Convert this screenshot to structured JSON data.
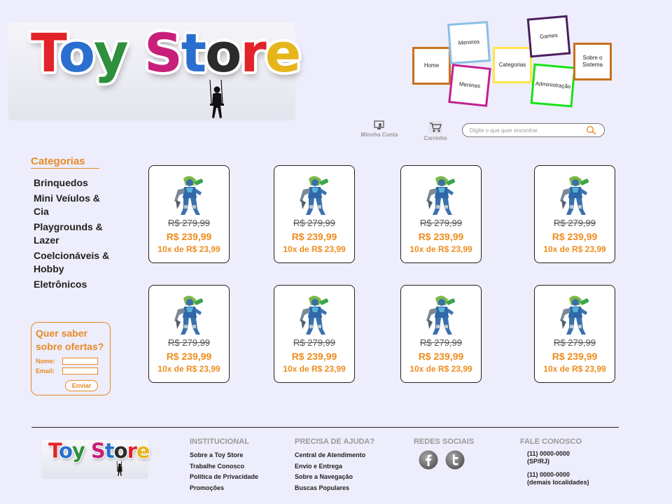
{
  "brand": {
    "logo_letters": [
      {
        "char": "T",
        "color": "#e2232b"
      },
      {
        "char": "o",
        "color": "#2a6fcf"
      },
      {
        "char": "y",
        "color": "#2e8f3c"
      },
      {
        "char": " ",
        "color": "#000000"
      },
      {
        "char": "S",
        "color": "#c8207a"
      },
      {
        "char": "t",
        "color": "#2a6fcf"
      },
      {
        "char": "o",
        "color": "#2b2b2b"
      },
      {
        "char": "r",
        "color": "#e2232b"
      },
      {
        "char": "e",
        "color": "#e5b51a"
      }
    ],
    "logo_text": "Toy Store"
  },
  "nav": {
    "home": "Home",
    "meninos": "Meninos",
    "meninas": "Meninas",
    "categorias": "Categorias",
    "games": "Games",
    "administracao": "Administração",
    "sobre": "Sobre o Sistema"
  },
  "header": {
    "account_label": "Minnha Conta",
    "cart_label": "Carrinho",
    "search_placeholder": "Digite o que quer encontrar"
  },
  "sidebar": {
    "title": "Categorias",
    "items": [
      {
        "label": "Brinquedos"
      },
      {
        "label": "Mini Veíulos & Cia"
      },
      {
        "label": "Playgrounds & Lazer"
      },
      {
        "label": "Coelcionáveis & Hobby"
      },
      {
        "label": "Eletrônicos"
      }
    ],
    "offers": {
      "title": "Quer saber sobre ofertas?",
      "name_label": "Nome:",
      "email_label": "Email:",
      "submit_label": "Enviar"
    }
  },
  "products": [
    {
      "old_price": "R$ 279,99",
      "price": "R$ 239,99",
      "installments": "10x de R$ 23,99"
    },
    {
      "old_price": "R$ 279,99",
      "price": "R$ 239,99",
      "installments": "10x de R$ 23,99"
    },
    {
      "old_price": "R$ 279,99",
      "price": "R$ 239,99",
      "installments": "10x de R$ 23,99"
    },
    {
      "old_price": "R$ 279,99",
      "price": "R$ 239,99",
      "installments": "10x de R$ 23,99"
    },
    {
      "old_price": "R$ 279,99",
      "price": "R$ 239,99",
      "installments": "10x de R$ 23,99"
    },
    {
      "old_price": "R$ 279,99",
      "price": "R$ 239,99",
      "installments": "10x de R$ 23,99"
    },
    {
      "old_price": "R$ 279,99",
      "price": "R$ 239,99",
      "installments": "10x de R$ 23,99"
    },
    {
      "old_price": "R$ 279,99",
      "price": "R$ 239,99",
      "installments": "10x de R$ 23,99"
    }
  ],
  "footer": {
    "institucional": {
      "heading": "INSTITUCIONAL",
      "items": [
        "Sobre a Toy Store",
        "Trabalhe Conosco",
        "Política de Privacidade",
        "Promoções"
      ]
    },
    "ajuda": {
      "heading": "PRECISA DE AJUDA?",
      "items": [
        "Central de Atendimento",
        "Envio e Entrega",
        "Sobre a Navegação",
        "Buscas Populares"
      ]
    },
    "social": {
      "heading": "REDES SOCIAIS",
      "icons": [
        "facebook-icon",
        "twitter-icon"
      ]
    },
    "contato": {
      "heading": "FALE CONOSCO",
      "phone1": "(11) 0000-0000",
      "region1": "(SP/RJ)",
      "phone2": "(11) 0000-0000",
      "region2": "(demais localidades)"
    }
  },
  "colors": {
    "accent": "#e88a26",
    "price": "#ee8c1e",
    "background": "#ededfb"
  }
}
